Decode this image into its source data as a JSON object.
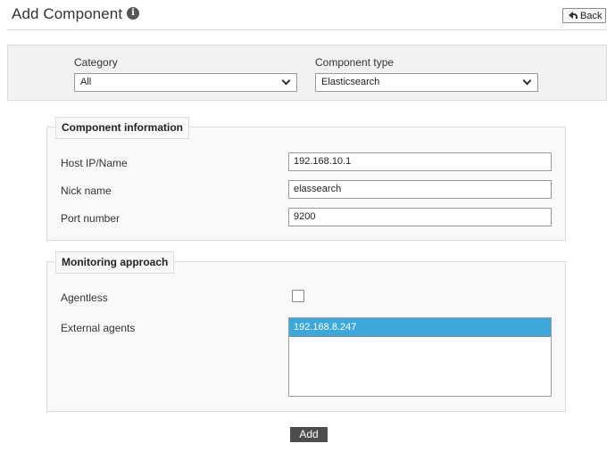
{
  "header": {
    "title": "Add Component",
    "info_icon": "info-icon",
    "back_label": "Back",
    "back_icon": "back-arrow-icon"
  },
  "filters": {
    "category_label": "Category",
    "category_value": "All",
    "component_type_label": "Component type",
    "component_type_value": "Elasticsearch"
  },
  "component_information": {
    "legend": "Component information",
    "host_label": "Host IP/Name",
    "host_value": "192.168.10.1",
    "nick_label": "Nick name",
    "nick_value": "elassearch",
    "port_label": "Port number",
    "port_value": "9200"
  },
  "monitoring_approach": {
    "legend": "Monitoring approach",
    "agentless_label": "Agentless",
    "agentless_checked": false,
    "external_agents_label": "External agents",
    "external_agents_options": [
      "192.168.8.247"
    ]
  },
  "actions": {
    "add_label": "Add"
  },
  "colors": {
    "selected_option": "#3ba8d9",
    "add_button": "#4d4d4d",
    "panel_background": "#f2f2f2"
  }
}
